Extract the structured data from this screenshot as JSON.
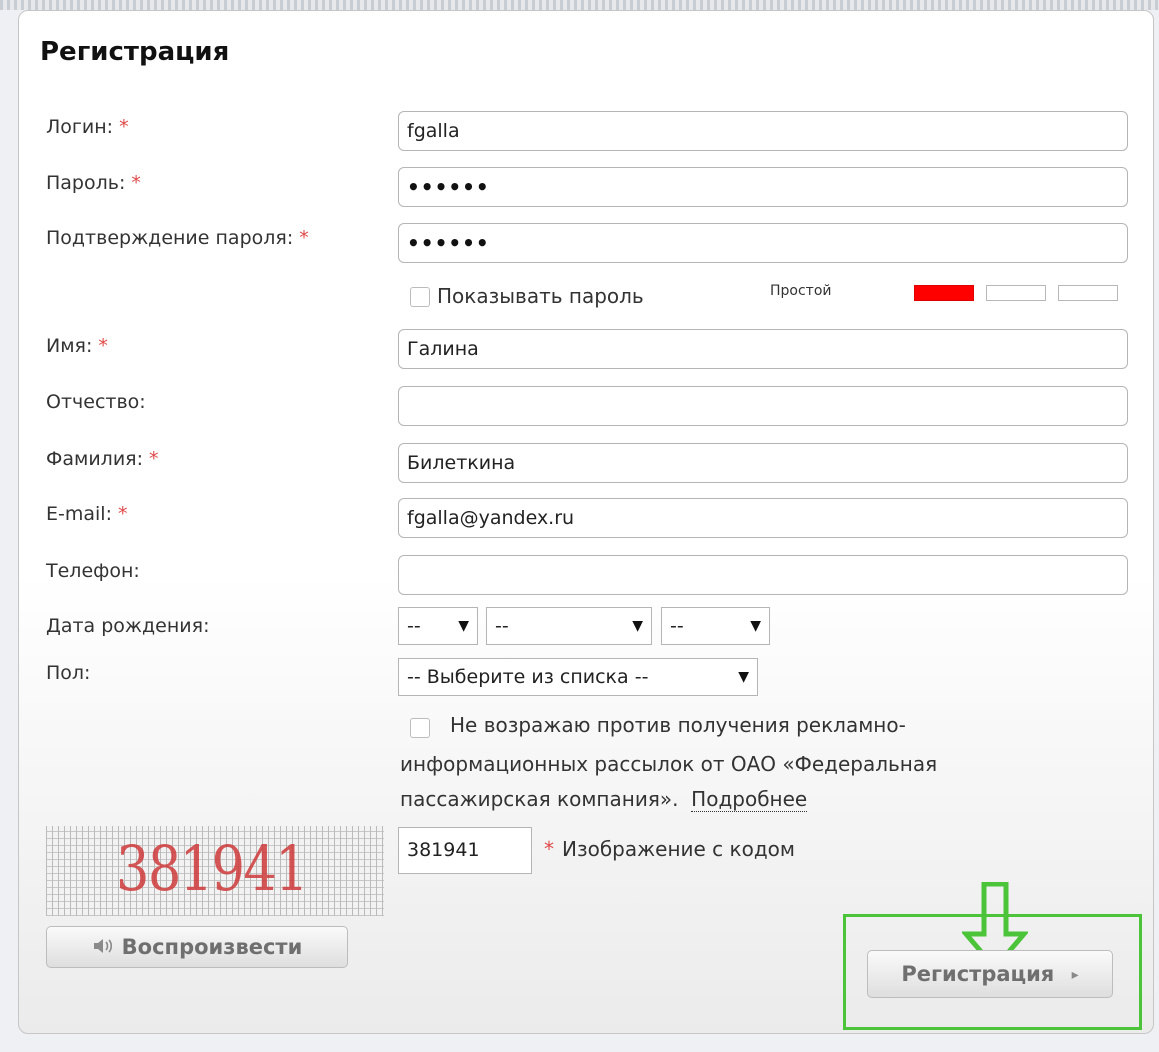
{
  "form": {
    "title": "Регистрация",
    "required_mark": "*",
    "login": {
      "label": "Логин:",
      "value": "fgalla"
    },
    "password": {
      "label": "Пароль:",
      "value": "••••••"
    },
    "password_confirm": {
      "label": "Подтверждение пароля:",
      "value": "••••••"
    },
    "show_password": {
      "label": "Показывать пароль",
      "checked": false
    },
    "strength": {
      "label": "Простой",
      "level": 1,
      "max": 3,
      "color": "#ff0000"
    },
    "first_name": {
      "label": "Имя:",
      "value": "Галина"
    },
    "middle_name": {
      "label": "Отчество:",
      "value": ""
    },
    "last_name": {
      "label": "Фамилия:",
      "value": "Билеткина"
    },
    "email": {
      "label": "E-mail:",
      "value": "fgalla@yandex.ru"
    },
    "phone": {
      "label": "Телефон:",
      "value": ""
    },
    "birth_date": {
      "label": "Дата рождения:",
      "day": "--",
      "month": "--",
      "year": "--"
    },
    "gender": {
      "label": "Пол:",
      "value": "-- Выберите из списка --"
    },
    "consent": {
      "line1": "Не возражаю против получения рекламно-",
      "line2": "информационных рассылок от ОАО «Федеральная",
      "line3": "пассажирская компания».",
      "more_link": "Подробнее",
      "checked": false
    },
    "captcha": {
      "image_text": "381941",
      "value": "381941",
      "label": "Изображение с кодом"
    },
    "play_button": {
      "label": "Воспроизвести",
      "icon": "speaker-icon"
    },
    "submit_button": {
      "label": "Регистрация",
      "icon": "triangle-right-icon"
    }
  },
  "annotation": {
    "color": "#4bc43a",
    "arrow": "down-arrow"
  }
}
